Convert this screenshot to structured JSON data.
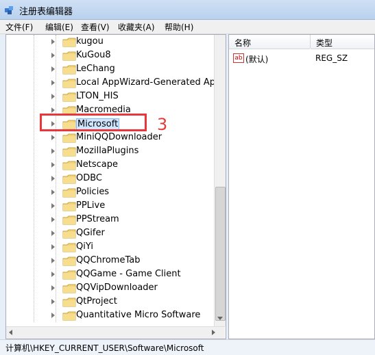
{
  "window": {
    "title": "注册表编辑器"
  },
  "menu": [
    "文件(F)",
    "编辑(E)",
    "查看(V)",
    "收藏夹(A)",
    "帮助(H)"
  ],
  "tree": {
    "items": [
      {
        "label": "kugou"
      },
      {
        "label": "KuGou8"
      },
      {
        "label": "LeChang"
      },
      {
        "label": "Local AppWizard-Generated Appli"
      },
      {
        "label": "LTON_HIS"
      },
      {
        "label": "Macromedia"
      },
      {
        "label": "Microsoft",
        "selected": true
      },
      {
        "label": "MiniQQDownloader"
      },
      {
        "label": "MozillaPlugins"
      },
      {
        "label": "Netscape"
      },
      {
        "label": "ODBC"
      },
      {
        "label": "Policies"
      },
      {
        "label": "PPLive"
      },
      {
        "label": "PPStream"
      },
      {
        "label": "QGifer"
      },
      {
        "label": "QiYi"
      },
      {
        "label": "QQChromeTab"
      },
      {
        "label": "QQGame - Game Client"
      },
      {
        "label": "QQVipDownloader"
      },
      {
        "label": "QtProject"
      },
      {
        "label": "Quantitative Micro Software"
      }
    ]
  },
  "values": {
    "headers": {
      "name": "名称",
      "type": "类型"
    },
    "rows": [
      {
        "icon": "ab",
        "name": "(默认)",
        "type": "REG_SZ"
      }
    ]
  },
  "statusbar": {
    "path": "计算机\\HKEY_CURRENT_USER\\Software\\Microsoft"
  },
  "annotation": {
    "number": "3"
  },
  "colors": {
    "highlight": "#e8363a",
    "selection": "#cfe6ff"
  }
}
